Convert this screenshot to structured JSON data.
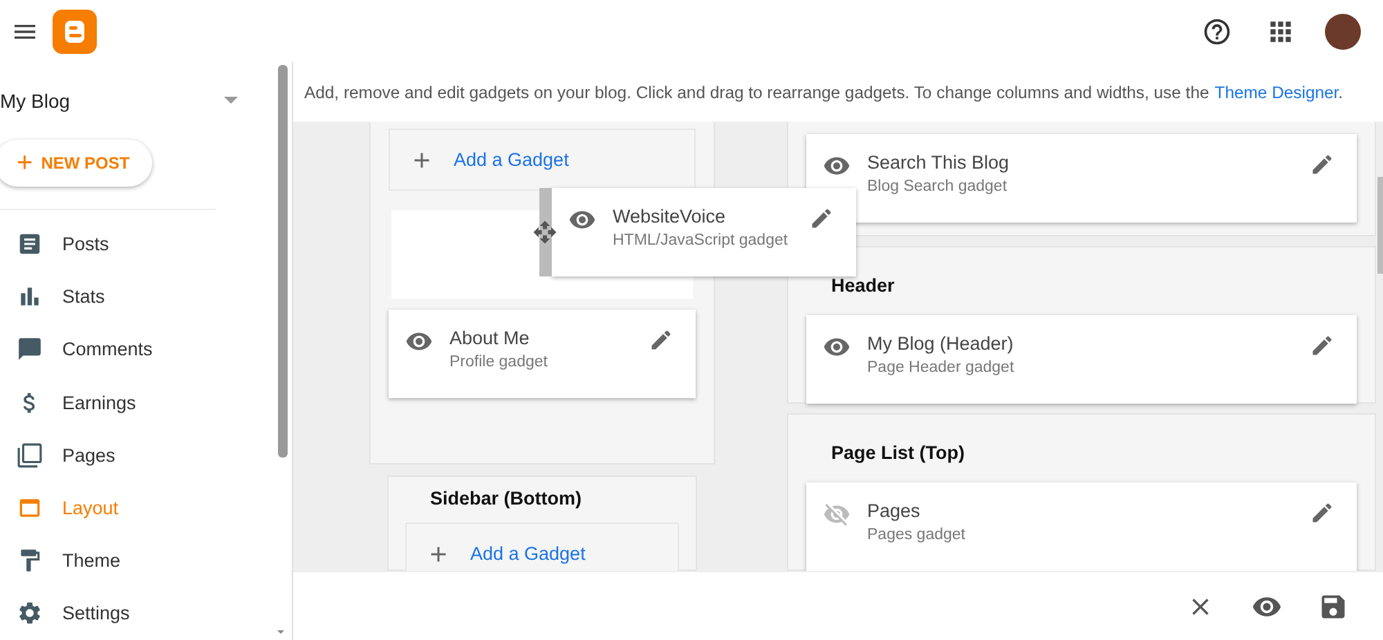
{
  "blog_selector": {
    "value": "My Blog"
  },
  "new_post_button": {
    "icon": "+",
    "label": "NEW POST"
  },
  "sidebar": {
    "items": [
      {
        "label": "Posts",
        "selected": false
      },
      {
        "label": "Stats",
        "selected": false
      },
      {
        "label": "Comments",
        "selected": false
      },
      {
        "label": "Earnings",
        "selected": false
      },
      {
        "label": "Pages",
        "selected": false
      },
      {
        "label": "Layout",
        "selected": true
      },
      {
        "label": "Theme",
        "selected": false
      },
      {
        "label": "Settings",
        "selected": false
      }
    ]
  },
  "info_bar": {
    "text": "Add, remove and edit gadgets on your blog. Click and drag to rearrange gadgets. To change columns and widths, use the",
    "link": "Theme Designer",
    "end": "."
  },
  "left_column": {
    "sections": [
      {
        "add_gadget": "Add a Gadget",
        "gadgets": [
          {
            "kind": "drop_slot"
          },
          {
            "kind": "gadget",
            "name": "About Me",
            "type": "Profile gadget",
            "visible": true
          }
        ]
      },
      {
        "title": "Sidebar (Bottom)",
        "add_gadget": "Add a Gadget"
      }
    ]
  },
  "right_column": {
    "sections": [
      {
        "gadgets": [
          {
            "name": "Search This Blog",
            "type": "Blog Search gadget",
            "visible": true
          }
        ]
      },
      {
        "title": "Header",
        "gadgets": [
          {
            "name": "My Blog (Header)",
            "type": "Page Header gadget",
            "visible": true
          }
        ]
      },
      {
        "title": "Page List (Top)",
        "gadgets": [
          {
            "name": "Pages",
            "type": "Pages gadget",
            "visible": false
          }
        ]
      }
    ]
  },
  "dragged_gadget": {
    "name": "WebsiteVoice",
    "type": "HTML/JavaScript gadget",
    "visible": true
  }
}
